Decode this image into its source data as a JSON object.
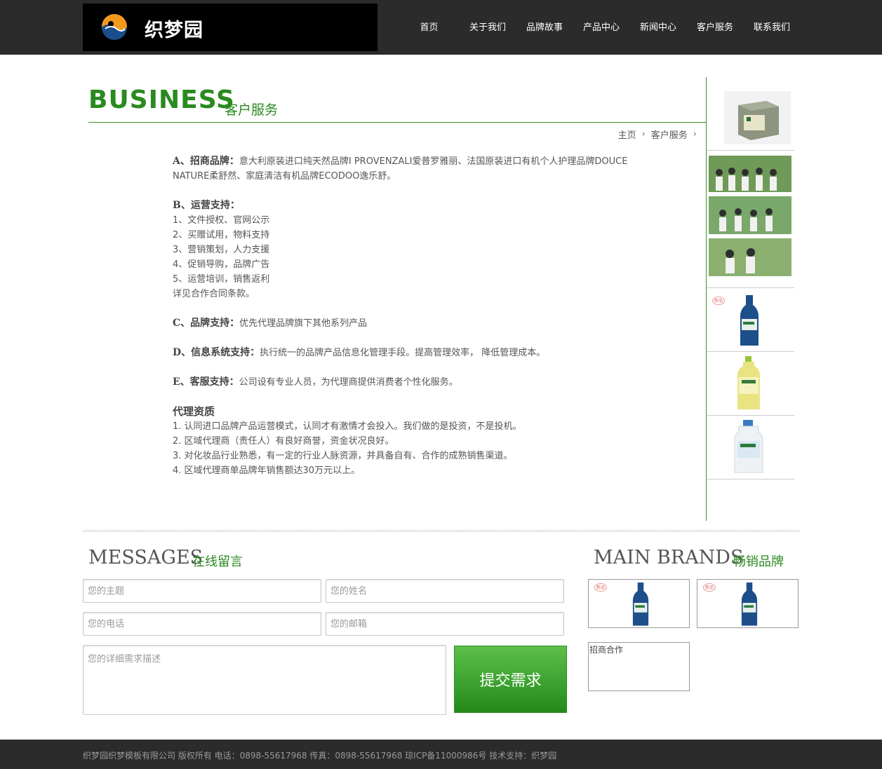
{
  "header": {
    "logo_text": "织梦园",
    "nav": [
      "首页",
      "关于我们",
      "品牌故事",
      "产品中心",
      "新闻中心",
      "客户服务",
      "联系我们"
    ]
  },
  "section": {
    "title_en": "BUSINESS",
    "title_cn": "客户服务",
    "breadcrumb": [
      "主页",
      "客户服务"
    ]
  },
  "article": {
    "a_head": "A、招商品牌：",
    "a_text_1": "意大利原装进口纯天然品牌I PROVENZALI爱普罗雅丽、法国原装进口有机个人护理品牌DOUCE",
    "a_text_2": "NATURE柔舒然、家庭清洁有机品牌ECODOO逸乐舒。",
    "b_head": "B、运营支持：",
    "b_items": [
      "1、文件授权、官网公示",
      "2、买赠试用，物料支持",
      "3、营销策划，人力支援",
      "4、促销导购，品牌广告",
      "5、运营培训，销售返利",
      "详见合作合同条款。"
    ],
    "c_head": "C、品牌支持：",
    "c_text": "优先代理品牌旗下其他系列产品",
    "d_head": "D、信息系统支持：",
    "d_text": "执行统一的品牌产品信息化管理手段。提高管理效率， 降低管理成本。",
    "e_head": "E、客服支持：",
    "e_text": "公司设有专业人员，为代理商提供消费者个性化服务。",
    "q_head": "代理资质",
    "q_items": [
      "1. 认同进口品牌产品运营模式，认同才有激情才会投入。我们做的是投资，不是投机。",
      "2. 区域代理商（责任人）有良好商誉，资金状况良好。",
      "3. 对化妆品行业熟悉，有一定的行业人脉资源，并具备自有、合作的成熟销售渠道。",
      "4. 区域代理商单品牌年销售额达30万元以上。"
    ]
  },
  "messages": {
    "title_en": "MESSAGES",
    "title_cn": "在线留言",
    "subject_placeholder": "您的主题",
    "name_placeholder": "您的姓名",
    "phone_placeholder": "您的电话",
    "email_placeholder": "您的邮箱",
    "detail_placeholder": "您的详细需求描述",
    "submit_label": "提交需求"
  },
  "brands": {
    "title_en": "MAIN BRANDS",
    "title_cn": "畅销品牌",
    "text_card": "招商合作",
    "new_badge": "新品"
  },
  "footer": {
    "text": "织梦园织梦模板有限公司 版权所有 电话：0898-55617968 传真：0898-55617968 琼ICP备11000986号 技术支持：织梦园"
  },
  "colors": {
    "accent_green": "#2a8a1f",
    "header_bg": "#2b2b2b"
  }
}
